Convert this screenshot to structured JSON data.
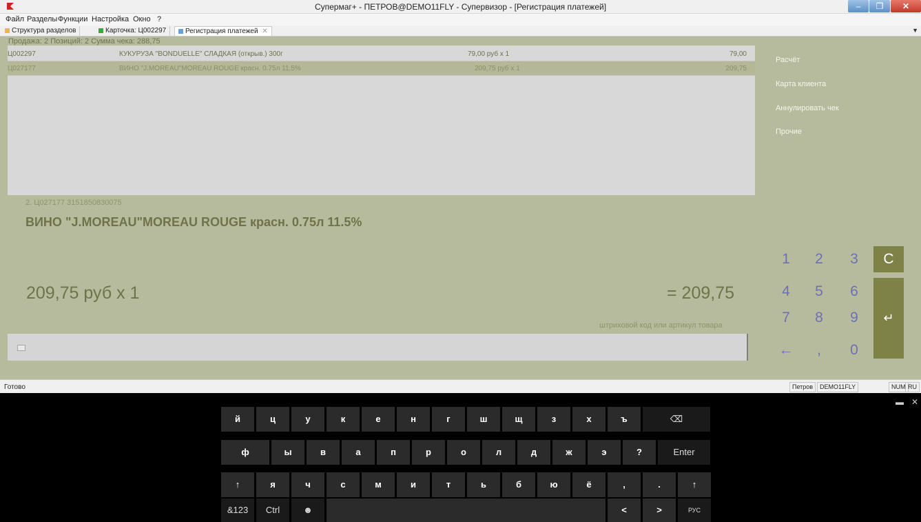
{
  "window": {
    "title": "Супермаг+ - ПЕТРОВ@DEMO11FLY - Супервизор - [Регистрация платежей]",
    "controls": {
      "min": "–",
      "max": "❐",
      "close": "✕"
    }
  },
  "menu": [
    "Файл",
    "Разделы",
    "Функции",
    "Настройка",
    "Окно",
    "?"
  ],
  "tabs": [
    "Структура разделов",
    "Карточка: Ц002297",
    "Регистрация платежей"
  ],
  "summary": "Продажа: 2   Позиций: 2   Сумма чека: 288,75",
  "items": [
    {
      "code": "Ц002297",
      "name": "КУКУРУЗА \"BONDUELLE\" СЛАДКАЯ (открыв.) 300г",
      "price_qty": "79,00 руб   x 1",
      "sum": "79,00"
    },
    {
      "code": "Ц027177",
      "name": "ВИНО \"J.MOREAU\"MOREAU ROUGE красн. 0.75л 11.5%",
      "price_qty": "209,75 руб   x 1",
      "sum": "209,75"
    }
  ],
  "detail": {
    "header": "2.  Ц027177  3151850830075",
    "name": "ВИНО \"J.MOREAU\"MOREAU ROUGE красн. 0.75л 11.5%",
    "price_qty": "209,75 руб x 1",
    "total": "= 209,75"
  },
  "input_hint": "штриховой код или артикул товара",
  "right_panel": [
    "Расчёт",
    "Карта клиента",
    "Аннулировать чек",
    "Прочие"
  ],
  "numpad": {
    "row1": [
      "1",
      "2",
      "3"
    ],
    "row2": [
      "4",
      "5",
      "6"
    ],
    "row3": [
      "7",
      "8",
      "9"
    ],
    "row4": [
      "←",
      ",",
      "0"
    ],
    "clear": "C",
    "enter": "↵"
  },
  "status": {
    "text": "Готово",
    "user": "Петров",
    "db": "DEMO11FLY",
    "num": "NUM",
    "lang": "RU"
  },
  "keyboard": {
    "row1": [
      "й",
      "ц",
      "у",
      "к",
      "е",
      "н",
      "г",
      "ш",
      "щ",
      "з",
      "х",
      "ъ"
    ],
    "backspace": "⌫",
    "row2": [
      "ф",
      "ы",
      "в",
      "а",
      "п",
      "р",
      "о",
      "л",
      "д",
      "ж",
      "э",
      "?"
    ],
    "enter": "Enter",
    "row3": [
      "↑",
      "я",
      "ч",
      "с",
      "м",
      "и",
      "т",
      "ь",
      "б",
      "ю",
      "ё",
      ",",
      ".",
      "↑"
    ],
    "row4": {
      "sym": "&123",
      "ctrl": "Ctrl",
      "emoji": "☻",
      "left": "<",
      "right": ">",
      "lang": "РУС"
    },
    "window_controls": {
      "dock": "▬",
      "close": "✕"
    }
  }
}
